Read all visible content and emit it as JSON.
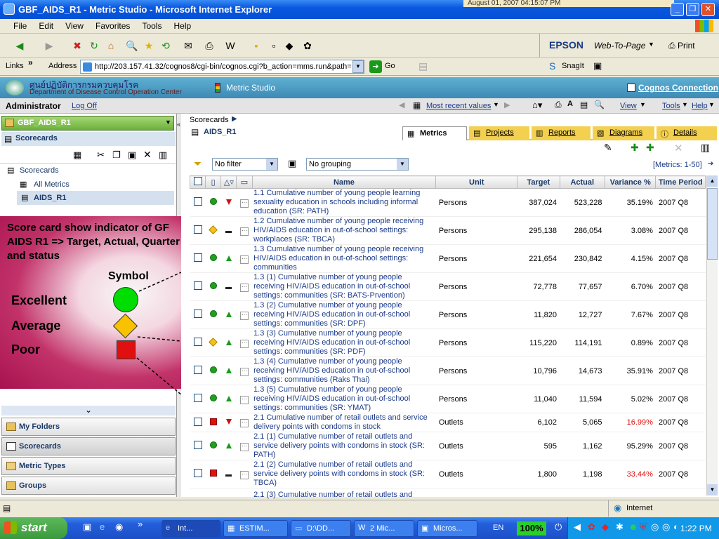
{
  "window": {
    "title": "GBF_AIDS_R1 - Metric Studio - Microsoft Internet Explorer",
    "datetime_overlay": "August 01, 2007 04:15:07 PM"
  },
  "menu": [
    "File",
    "Edit",
    "View",
    "Favorites",
    "Tools",
    "Help"
  ],
  "toolbar": {
    "epson": "EPSON",
    "web_to_page": "Web-To-Page",
    "print": "Print",
    "snagit": "SnagIt"
  },
  "address": {
    "links_label": "Links",
    "label": "Address",
    "url": "http://203.157.41.32/cognos8/cgi-bin/cognos.cgi?b_action=mms.run&path=",
    "go": "Go"
  },
  "banner": {
    "org_thai": "ศูนย์ปฏิบัติการกรมควบคุมโรค",
    "org_en": "Department of Disease Control Operation Center",
    "app": "Metric Studio",
    "cognos_link": "Cognos Connection"
  },
  "pagebar": {
    "user": "Administrator",
    "logoff": "Log Off",
    "most_recent": "Most recent values",
    "view": "View",
    "tools": "Tools",
    "help": "Help"
  },
  "left": {
    "package": "GBF_AIDS_R1",
    "section": "Scorecards",
    "tree": [
      "Scorecards",
      "All Metrics",
      "AIDS_R1"
    ],
    "nav": [
      "My Folders",
      "Scorecards",
      "Metric Types",
      "Groups"
    ]
  },
  "annotation": {
    "heading": "Score card show indicator of GF AIDS R1 => Target, Actual, Quarter and status",
    "symbol": "Symbol",
    "excellent": "Excellent",
    "average": "Average",
    "poor": "Poor",
    "colors": {
      "excellent": "#00dd00",
      "average": "#f8c200",
      "poor": "#e01010"
    }
  },
  "main": {
    "breadcrumb": "Scorecards",
    "current": "AIDS_R1",
    "tabs": [
      "Metrics",
      "Projects",
      "Reports",
      "Diagrams",
      "Details"
    ],
    "filter": "No filter",
    "grouping": "No grouping",
    "paging": "[Metrics: 1-50]",
    "columns": [
      "Name",
      "Unit",
      "Target",
      "Actual",
      "Variance %",
      "Time Period"
    ],
    "rows": [
      {
        "status": "circle",
        "trend": "down",
        "name": "1.1 Cumulative number of young people learning sexuality education in schools including informal education (SR: PATH)",
        "unit": "Persons",
        "target": "387,024",
        "actual": "523,228",
        "variance": "35.19%",
        "period": "2007 Q8",
        "red": false
      },
      {
        "status": "diamond",
        "trend": "flat",
        "name": "1.2 Cumulative number of young people receiving HIV/AIDS education in out-of-school settings: workplaces (SR: TBCA)",
        "unit": "Persons",
        "target": "295,138",
        "actual": "286,054",
        "variance": "3.08%",
        "period": "2007 Q8",
        "red": false
      },
      {
        "status": "circle",
        "trend": "up",
        "name": "1.3 Cumulative number of young people receiving HIV/AIDS education in out-of-school settings: communities",
        "unit": "Persons",
        "target": "221,654",
        "actual": "230,842",
        "variance": "4.15%",
        "period": "2007 Q8",
        "red": false
      },
      {
        "status": "circle",
        "trend": "flat",
        "name": "1.3 (1) Cumulative number of young people receiving HIV/AIDS education in out-of-school settings: communities (SR: BATS-Prvention)",
        "unit": "Persons",
        "target": "72,778",
        "actual": "77,657",
        "variance": "6.70%",
        "period": "2007 Q8",
        "red": false
      },
      {
        "status": "circle",
        "trend": "up",
        "name": "1.3 (2) Cumulative number of young people receiving HIV/AIDS education in out-of-school settings: communities (SR: DPF)",
        "unit": "Persons",
        "target": "11,820",
        "actual": "12,727",
        "variance": "7.67%",
        "period": "2007 Q8",
        "red": false
      },
      {
        "status": "diamond",
        "trend": "up",
        "name": "1.3 (3) Cumulative number of young people receiving HIV/AIDS education in out-of-school settings: communities (SR: PDF)",
        "unit": "Persons",
        "target": "115,220",
        "actual": "114,191",
        "variance": "0.89%",
        "period": "2007 Q8",
        "red": false
      },
      {
        "status": "circle",
        "trend": "up",
        "name": "1.3 (4) Cumulative number of young people receiving HIV/AIDS education in out-of-school settings: communities (Raks Thai)",
        "unit": "Persons",
        "target": "10,796",
        "actual": "14,673",
        "variance": "35.91%",
        "period": "2007 Q8",
        "red": false
      },
      {
        "status": "circle",
        "trend": "up",
        "name": "1.3 (5) Cumulative number of young people receiving HIV/AIDS education in out-of-school settings: communities (SR: YMAT)",
        "unit": "Persons",
        "target": "11,040",
        "actual": "11,594",
        "variance": "5.02%",
        "period": "2007 Q8",
        "red": false
      },
      {
        "status": "square",
        "trend": "down",
        "name": "2.1 Cumulative number of retail outlets and service delivery points with condoms in stock",
        "unit": "Outlets",
        "target": "6,102",
        "actual": "5,065",
        "variance": "16.99%",
        "period": "2007 Q8",
        "red": true
      },
      {
        "status": "circle",
        "trend": "up",
        "name": "2.1 (1) Cumulative number of retail outlets and service delivery points with condoms in stock (SR: PATH)",
        "unit": "Outlets",
        "target": "595",
        "actual": "1,162",
        "variance": "95.29%",
        "period": "2007 Q8",
        "red": false
      },
      {
        "status": "square",
        "trend": "flat",
        "name": "2.1 (2) Cumulative number of retail outlets and service delivery points with condoms in stock (SR: TBCA)",
        "unit": "Outlets",
        "target": "1,800",
        "actual": "1,198",
        "variance": "33.44%",
        "period": "2007 Q8",
        "red": true
      },
      {
        "status": "none",
        "trend": "none",
        "name": "2.1 (3) Cumulative number of retail outlets and",
        "unit": "",
        "target": "",
        "actual": "",
        "variance": "",
        "period": "",
        "red": false
      }
    ]
  },
  "status": {
    "zone": "Internet"
  },
  "taskbar": {
    "start": "start",
    "tasks": [
      "Int...",
      "ESTIM...",
      "D:\\DD...",
      "2 Mic...",
      "Micros..."
    ],
    "lang": "EN",
    "zoom": "100%",
    "clock": "1:22 PM"
  }
}
